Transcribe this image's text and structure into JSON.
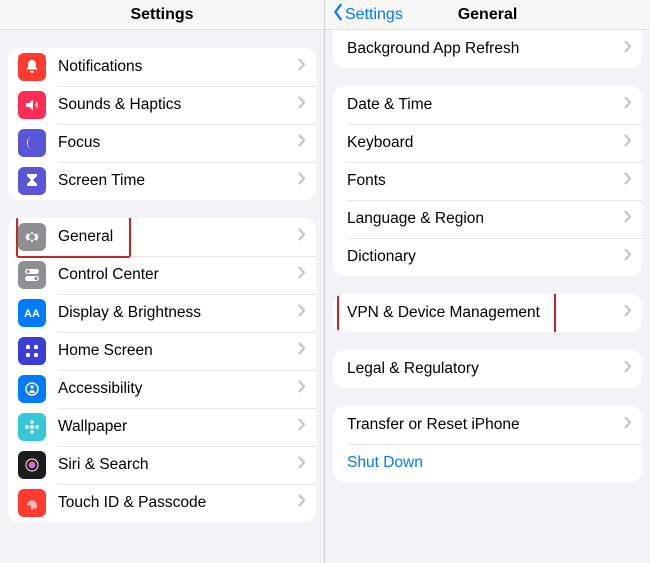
{
  "left": {
    "title": "Settings",
    "group1": [
      {
        "name": "notifications",
        "label": "Notifications",
        "icon": "bell",
        "bg": "#ff3b30"
      },
      {
        "name": "sounds",
        "label": "Sounds & Haptics",
        "icon": "speaker",
        "bg": "#ff2d55"
      },
      {
        "name": "focus",
        "label": "Focus",
        "icon": "moon",
        "bg": "#5856d6"
      },
      {
        "name": "screentime",
        "label": "Screen Time",
        "icon": "hourglass",
        "bg": "#5856d6"
      }
    ],
    "group2": [
      {
        "name": "general",
        "label": "General",
        "icon": "gear",
        "bg": "#8e8e93",
        "highlight": true
      },
      {
        "name": "controlcenter",
        "label": "Control Center",
        "icon": "switches",
        "bg": "#8e8e93"
      },
      {
        "name": "display",
        "label": "Display & Brightness",
        "icon": "aa",
        "bg": "#007aff"
      },
      {
        "name": "homescreen",
        "label": "Home Screen",
        "icon": "grid",
        "bg": "#3c3cd6"
      },
      {
        "name": "accessibility",
        "label": "Accessibility",
        "icon": "person",
        "bg": "#007aff"
      },
      {
        "name": "wallpaper",
        "label": "Wallpaper",
        "icon": "flower",
        "bg": "#34c8d9"
      },
      {
        "name": "siri",
        "label": "Siri & Search",
        "icon": "siri",
        "bg": "#1c1c1e"
      },
      {
        "name": "touchid",
        "label": "Touch ID & Passcode",
        "icon": "fingerprint",
        "bg": "#ff3b30"
      }
    ]
  },
  "right": {
    "back": "Settings",
    "title": "General",
    "group0": [
      {
        "name": "bgrefresh",
        "label": "Background App Refresh"
      }
    ],
    "group1": [
      {
        "name": "datetime",
        "label": "Date & Time"
      },
      {
        "name": "keyboard",
        "label": "Keyboard"
      },
      {
        "name": "fonts",
        "label": "Fonts"
      },
      {
        "name": "language",
        "label": "Language & Region"
      },
      {
        "name": "dictionary",
        "label": "Dictionary"
      }
    ],
    "group2": [
      {
        "name": "vpn",
        "label": "VPN & Device Management",
        "highlight": true
      }
    ],
    "group3": [
      {
        "name": "legal",
        "label": "Legal & Regulatory"
      }
    ],
    "group4": [
      {
        "name": "transfer",
        "label": "Transfer or Reset iPhone"
      },
      {
        "name": "shutdown",
        "label": "Shut Down",
        "link": true,
        "nochev": true
      }
    ]
  }
}
